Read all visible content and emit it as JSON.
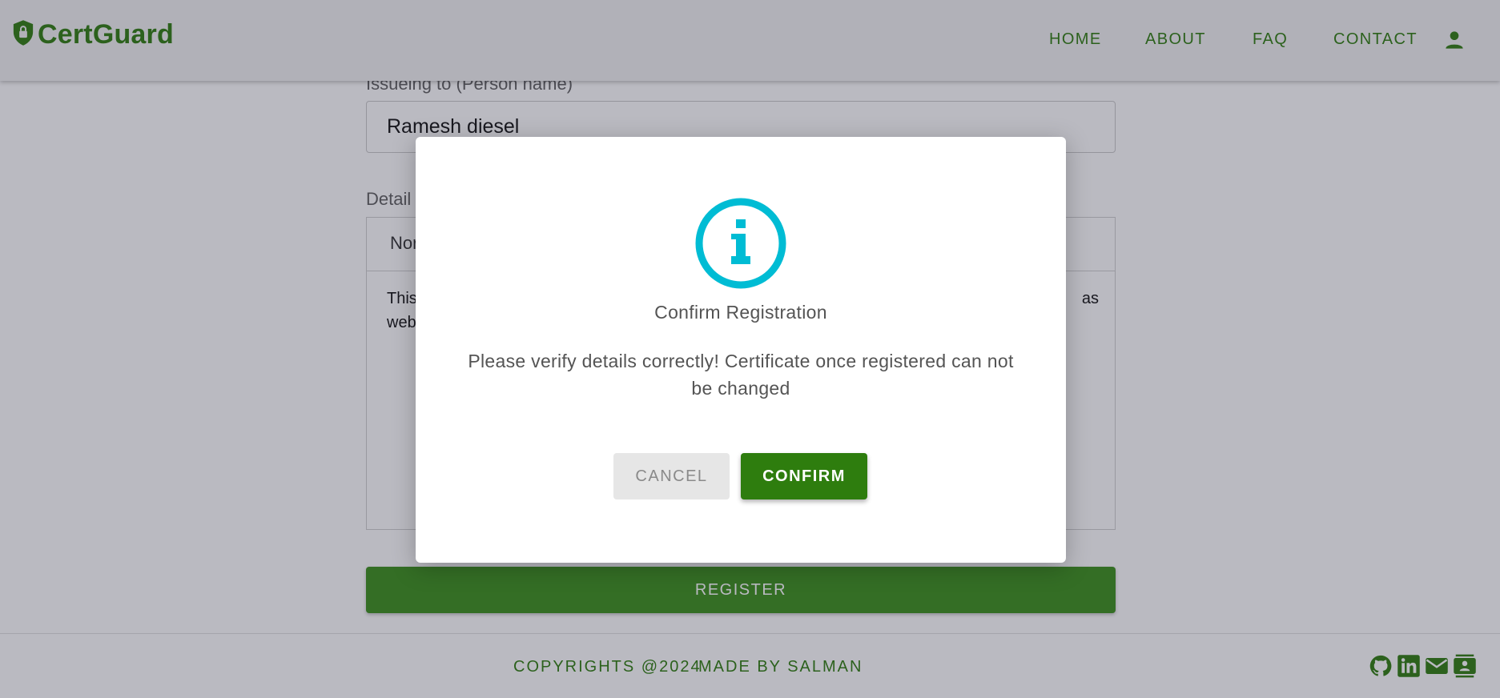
{
  "header": {
    "brand": "CertGuard",
    "nav": [
      {
        "label": "HOME"
      },
      {
        "label": "ABOUT"
      },
      {
        "label": "FAQ"
      },
      {
        "label": "CONTACT"
      }
    ]
  },
  "form": {
    "name_label": "Issueing to (Person name)",
    "name_value": "Ramesh diesel",
    "details_label": "Detail",
    "toolbar_text": "Nor",
    "body_line1_start": "This",
    "body_line1_end": "as",
    "body_line2_start": "web",
    "register_label": "REGISTER"
  },
  "footer": {
    "copyright": "COPYRIGHTS @2024",
    "made_by": "MADE BY SALMAN"
  },
  "modal": {
    "title": "Confirm Registration",
    "message": "Please verify details correctly! Certificate once registered can not be changed",
    "cancel_label": "CANCEL",
    "confirm_label": "CONFIRM"
  },
  "colors": {
    "brand_green": "#2e7d0e",
    "info_cyan": "#00bcd4"
  }
}
